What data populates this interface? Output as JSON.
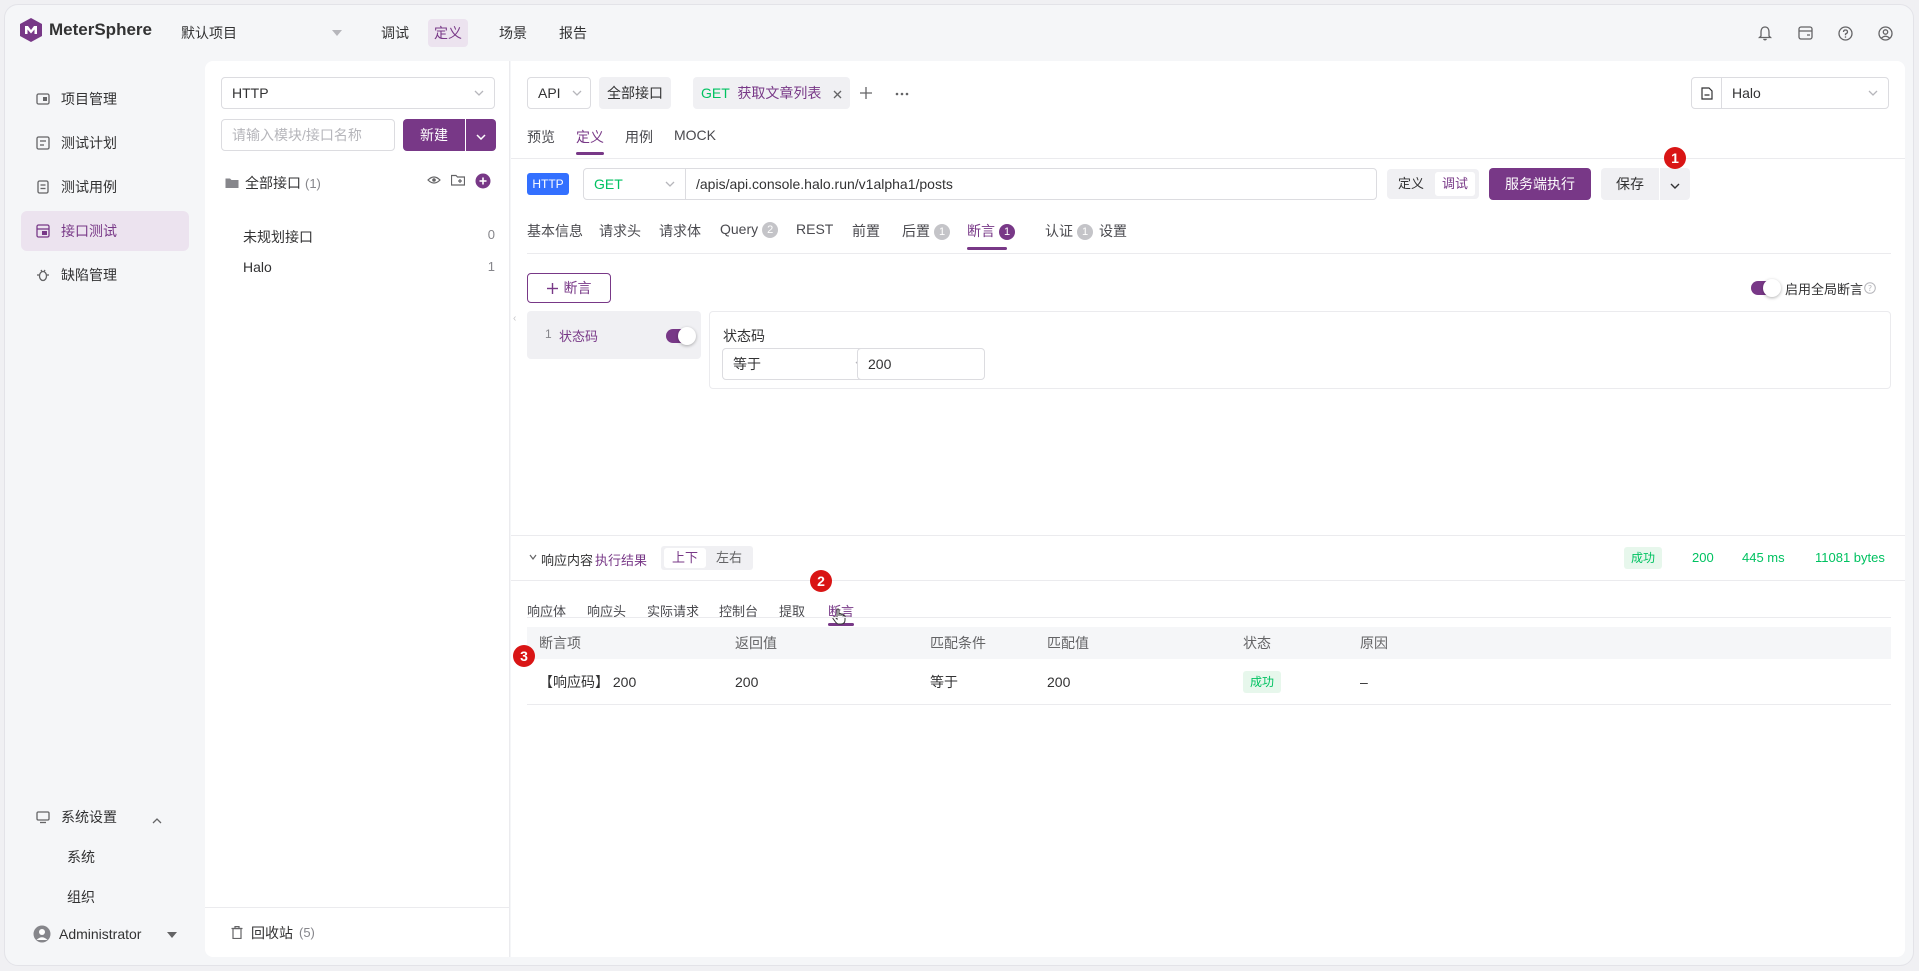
{
  "colors": {
    "primary": "#783887",
    "success": "#00c261",
    "http_badge": "#3370ff",
    "danger": "#d91515"
  },
  "topbar": {
    "brand": "MeterSphere",
    "project": "默认项目",
    "nav": [
      "调试",
      "定义",
      "场景",
      "报告"
    ],
    "icons": [
      "bell-icon",
      "task-center-icon",
      "help-icon",
      "user-settings-icon"
    ]
  },
  "sidebar": {
    "items": [
      {
        "label": "项目管理",
        "icon": "project-icon"
      },
      {
        "label": "测试计划",
        "icon": "test-plan-icon"
      },
      {
        "label": "测试用例",
        "icon": "test-case-icon"
      },
      {
        "label": "接口测试",
        "icon": "api-test-icon"
      },
      {
        "label": "缺陷管理",
        "icon": "bug-icon"
      }
    ],
    "system": {
      "label": "系统设置",
      "children": [
        "系统",
        "组织"
      ]
    },
    "user": "Administrator"
  },
  "tree": {
    "protocol": "HTTP",
    "search_placeholder": "请输入模块/接口名称",
    "new_button": "新建",
    "root_label": "全部接口",
    "root_count": "(1)",
    "modules": [
      {
        "name": "未规划接口",
        "count": "0"
      },
      {
        "name": "Halo",
        "count": "1"
      }
    ],
    "recycle_label": "回收站",
    "recycle_count": "(5)"
  },
  "workspace": {
    "type_select": "API",
    "all_api_tab": "全部接口",
    "active_tab_method": "GET",
    "active_tab_name": "获取文章列表",
    "env": "Halo",
    "subtabs": [
      "预览",
      "定义",
      "用例",
      "MOCK"
    ]
  },
  "request": {
    "protocol_badge": "HTTP",
    "method": "GET",
    "url": "/apis/api.console.halo.run/v1alpha1/posts",
    "mode_define": "定义",
    "mode_debug": "调试",
    "execute_button": "服务端执行",
    "save_button": "保存",
    "tabs": [
      {
        "label": "基本信息"
      },
      {
        "label": "请求头"
      },
      {
        "label": "请求体"
      },
      {
        "label": "Query",
        "count": "2"
      },
      {
        "label": "REST"
      },
      {
        "label": "前置"
      },
      {
        "label": "后置",
        "count": "1"
      },
      {
        "label": "断言",
        "count": "1"
      },
      {
        "label": "认证",
        "count": "1"
      },
      {
        "label": "设置"
      }
    ]
  },
  "assertion_config": {
    "add_button": "断言",
    "global_toggle_label": "启用全局断言",
    "item_index": "1",
    "item_label": "状态码",
    "detail_title": "状态码",
    "condition": "等于",
    "value": "200"
  },
  "response": {
    "title": "响应内容",
    "result_label": "执行结果",
    "layout_vertical": "上下",
    "layout_horizontal": "左右",
    "status_tag": "成功",
    "status_code": "200",
    "time": "445 ms",
    "size": "11081 bytes",
    "tabs": [
      "响应体",
      "响应头",
      "实际请求",
      "控制台",
      "提取",
      "断言"
    ],
    "table": {
      "headers": [
        "断言项",
        "返回值",
        "匹配条件",
        "匹配值",
        "状态",
        "原因"
      ],
      "rows": [
        {
          "item": "【响应码】 200",
          "returned": "200",
          "condition": "等于",
          "expected": "200",
          "status": "成功",
          "reason": "–"
        }
      ]
    }
  },
  "annotations": [
    "1",
    "2",
    "3"
  ]
}
